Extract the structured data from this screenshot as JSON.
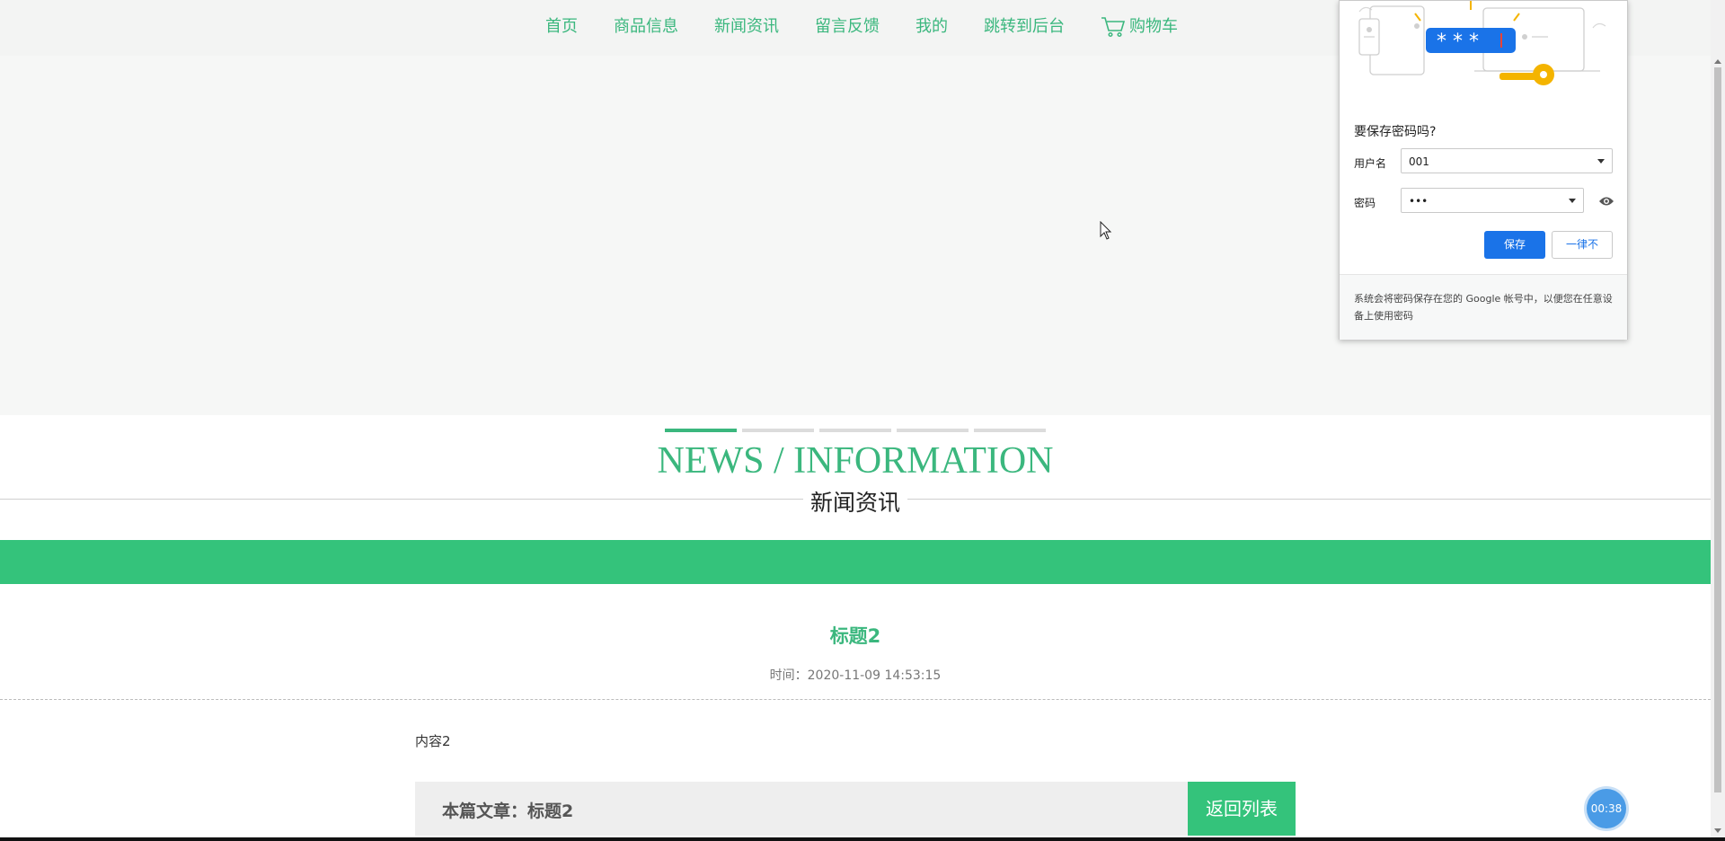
{
  "nav": {
    "items": [
      "首页",
      "商品信息",
      "新闻资讯",
      "留言反馈",
      "我的",
      "跳转到后台"
    ],
    "cart_label": "购物车"
  },
  "section": {
    "title_en": "NEWS / INFORMATION",
    "title_cn": "新闻资讯"
  },
  "article": {
    "title": "标题2",
    "time": "时间：2020-11-09 14:53:15",
    "content": "内容2",
    "current_label": "本篇文章：标题2",
    "back_label": "返回列表"
  },
  "timer": "00:38",
  "password_popup": {
    "title": "要保存密码吗?",
    "username_label": "用户名",
    "username_value": "001",
    "password_label": "密码",
    "password_value": "•••",
    "save_label": "保存",
    "never_label": "一律不",
    "footer_text": "系统会将密码保存在您的 Google 帐号中，以便您在任意设备上使用密码",
    "accent_color": "#1a73e8"
  },
  "colors": {
    "brand_green": "#3bb77e",
    "band_green": "#34c37b"
  }
}
